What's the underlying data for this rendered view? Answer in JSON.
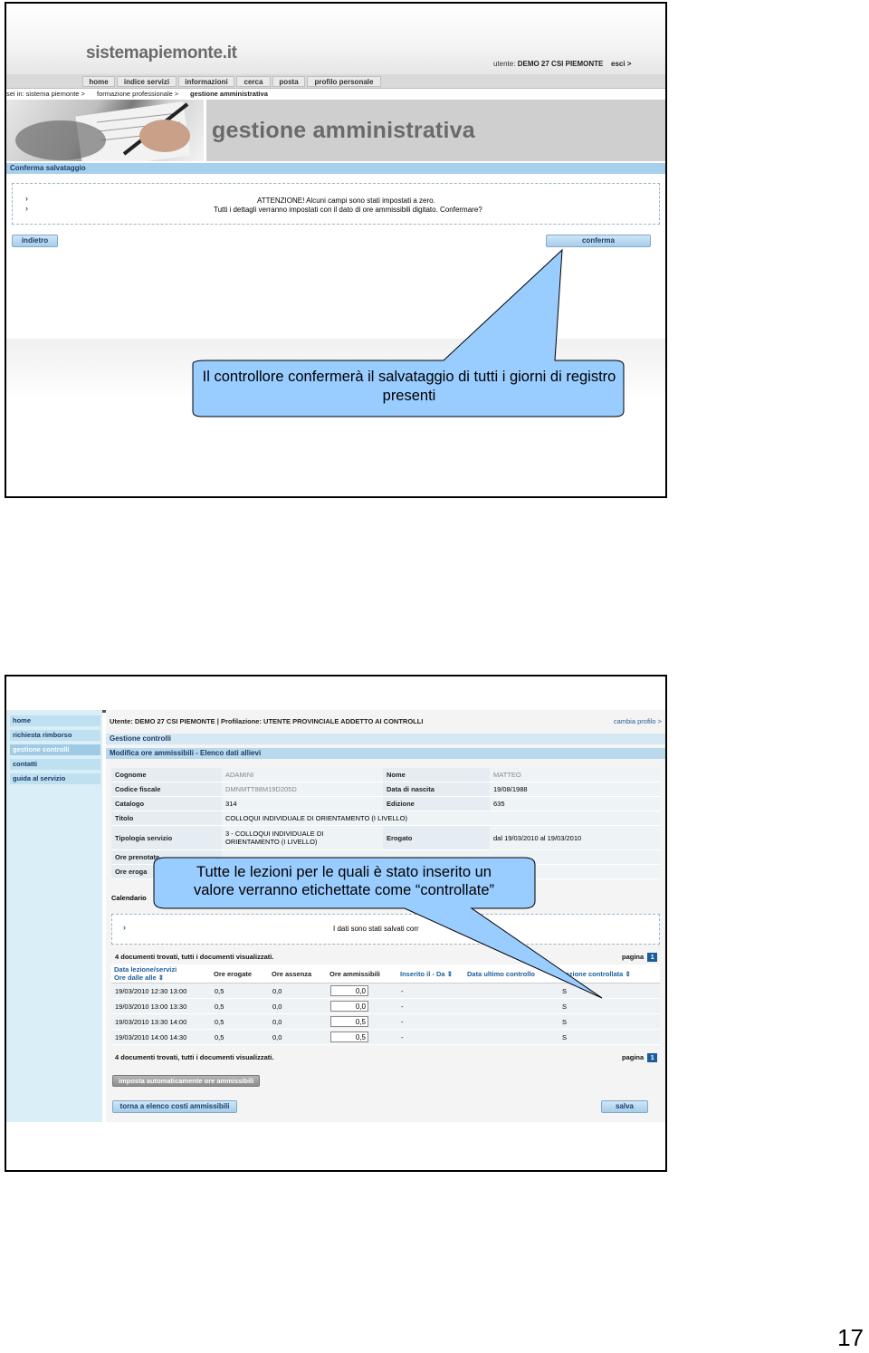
{
  "slide1": {
    "logo": "sistemapiemonte.it",
    "user_label": "utente:",
    "user_name": "DEMO 27 CSI PIEMONTE",
    "exit_label": "esci >",
    "nav": [
      "home",
      "indice servizi",
      "informazioni",
      "cerca",
      "posta",
      "profilo personale"
    ],
    "breadcrumb": [
      "sei in: sistema piemonte >",
      "formazione professionale >",
      "gestione amministrativa"
    ],
    "banner_title": "gestione amministrativa",
    "section_bar": "Conferma salvataggio",
    "alert_line1": "ATTENZIONE! Alcuni campi sono stati impostati a zero.",
    "alert_line2": "Tutti i dettagli verranno impostati con il dato di ore ammissibili digitato. Confermare?",
    "back_button": "indietro",
    "confirm_button": "conferma",
    "callout": "Il controllore confermerà il salvataggio di tutti i giorni di registro presenti"
  },
  "slide2": {
    "sidebar": [
      "home",
      "richiesta rimborso",
      "gestione controlli",
      "contatti",
      "guida al servizio"
    ],
    "user_bar": "Utente: DEMO 27 CSI PIEMONTE | Profilazione: UTENTE PROVINCIALE ADDETTO AI CONTROLLI",
    "profile_link": "cambia profilo >",
    "bar1": "Gestione controlli",
    "bar2": "Modifica ore ammissibili - Elenco dati allievi",
    "info": {
      "cognome_label": "Cognome",
      "cognome": "ADAMINI",
      "nome_label": "Nome",
      "nome": "MATTEO",
      "cf_label": "Codice fiscale",
      "cf": "DMNMTT88M19D205D",
      "nascita_label": "Data di nascita",
      "nascita": "19/08/1988",
      "catalogo_label": "Catalogo",
      "catalogo": "314",
      "edizione_label": "Edizione",
      "edizione": "635",
      "titolo_label": "Titolo",
      "titolo": "COLLOQUI INDIVIDUALE DI ORIENTAMENTO (I LIVELLO)",
      "tipologia_label": "Tipologia servizio",
      "tipologia": "3 - COLLOQUI INDIVIDUALE DI ORIENTAMENTO (I LIVELLO)",
      "erogato_label": "Erogato",
      "erogato": "dal 19/03/2010 al 19/03/2010",
      "ore_prenotate_label": "Ore prenotate",
      "ore_erogate_label": "Ore eroga"
    },
    "calendar_label": "Calendario",
    "saved_notice": "I dati sono stati salvati corr",
    "found_text": "4 documenti trovati, tutti i documenti visualizzati.",
    "page_label": "pagina",
    "page_number": "1",
    "columns": [
      "Data lezione/servizi",
      "Ore erogate",
      "Ore assenza",
      "Ore ammissibili",
      "Inserito il - Da",
      "Data ultimo controllo",
      "Lezione controllata"
    ],
    "column_sub": "Ore dalle alle",
    "rows": [
      [
        "19/03/2010 12:30 13:00",
        "0,5",
        "0,0",
        "0,0",
        "-",
        "",
        "S"
      ],
      [
        "19/03/2010 13:00 13:30",
        "0,5",
        "0,0",
        "0,0",
        "-",
        "",
        "S"
      ],
      [
        "19/03/2010 13:30 14:00",
        "0,5",
        "0,0",
        "0,5",
        "-",
        "",
        "S"
      ],
      [
        "19/03/2010 14:00 14:30",
        "0,5",
        "0,0",
        "0,5",
        "-",
        "",
        "S"
      ]
    ],
    "auto_button": "imposta automaticamente ore ammissibili",
    "back_button": "torna a elenco costi ammissibili",
    "save_button": "salva",
    "callout_line1": "Tutte le lezioni per le quali è stato inserito un",
    "callout_line2": "valore verranno etichettate come “controllate”"
  },
  "page_number": "17"
}
